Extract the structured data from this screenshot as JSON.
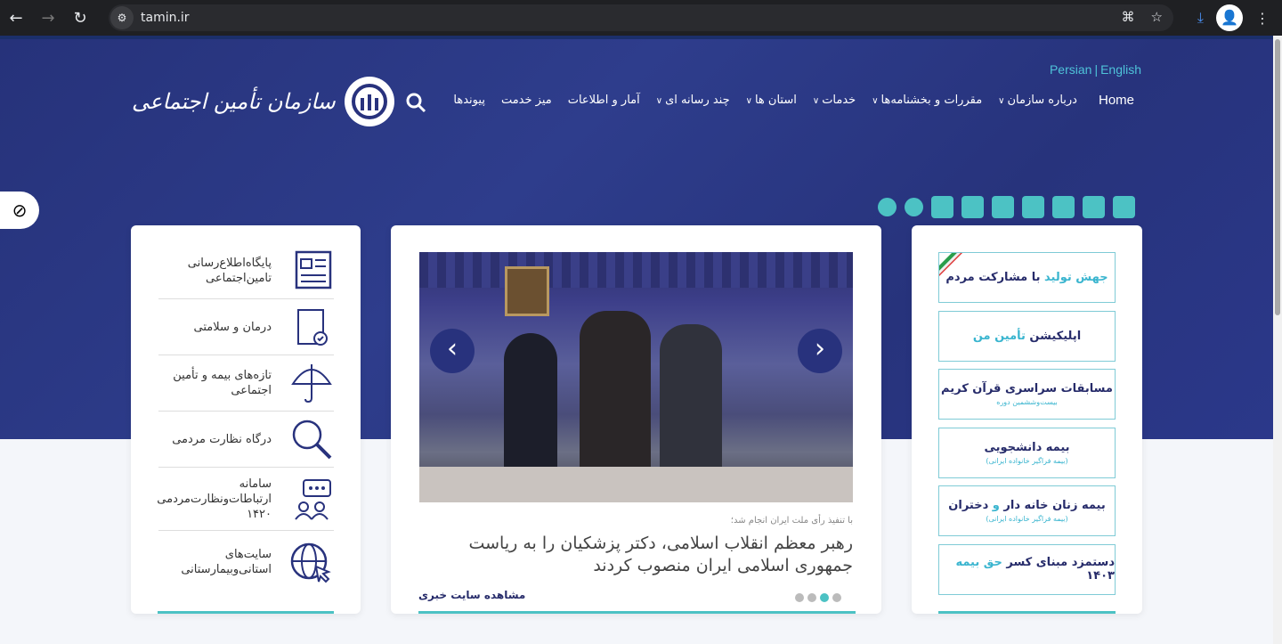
{
  "browser": {
    "url": "tamin.ir"
  },
  "header": {
    "lang": {
      "persian": "Persian",
      "english": "English"
    },
    "logo_text": "سازمان تأمین اجتماعی",
    "nav": [
      {
        "label": "Home",
        "dropdown": false
      },
      {
        "label": "درباره سازمان",
        "dropdown": true
      },
      {
        "label": "مقررات و بخشنامه‌ها",
        "dropdown": true
      },
      {
        "label": "خدمات",
        "dropdown": true
      },
      {
        "label": "استان ها",
        "dropdown": true
      },
      {
        "label": "چند رسانه ای",
        "dropdown": true
      },
      {
        "label": "آمار و اطلاعات",
        "dropdown": false
      },
      {
        "label": "میز خدمت",
        "dropdown": false
      },
      {
        "label": "پیوندها",
        "dropdown": false
      }
    ]
  },
  "toolbar_icons": [
    "zoom-out-icon",
    "zoom-in-icon",
    "sitemap-icon",
    "rss-icon",
    "mailbox-icon",
    "email-icon",
    "faq-icon",
    "mobile-icon",
    "home-icon"
  ],
  "left_panel": [
    {
      "label": "پایگاه‌اطلاع‌رسانی تامین‌اجتماعی",
      "icon": "newspaper-icon"
    },
    {
      "label": "درمان و سلامتی",
      "icon": "medical-report-icon"
    },
    {
      "label": "تازه‌های بیمه و تأمین اجتماعی",
      "icon": "umbrella-icon"
    },
    {
      "label": "درگاه نظارت مردمی",
      "icon": "magnifier-icon"
    },
    {
      "label": "سامانه ارتباطات‌ونظارت‌مردمی ۱۴۲۰",
      "icon": "chat-people-icon"
    },
    {
      "label": "سایت‌های استانی‌وبیمارستانی",
      "icon": "globe-cursor-icon"
    }
  ],
  "news": {
    "subtitle": "با تنفیذ رأی ملت ایران انجام شد؛",
    "headline": "رهبر معظم انقلاب اسلامی، دکتر پزشکیان را به ریاست جمهوری اسلامی ایران منصوب کردند",
    "more_link": "مشاهده سایت خبری",
    "slides": 4,
    "active_slide": 3
  },
  "right_panel": [
    {
      "parts": [
        {
          "t": "جهش تولید ",
          "c": true
        },
        {
          "t": "با مشارکت مردم",
          "c": false
        }
      ],
      "sub": ""
    },
    {
      "parts": [
        {
          "t": "اپلیکیشن ",
          "c": false
        },
        {
          "t": "تأمین من",
          "c": true
        }
      ],
      "sub": ""
    },
    {
      "parts": [
        {
          "t": "مسابقات سراسری قرآن کریم",
          "c": false
        }
      ],
      "sub": "بیست‌وششمین دوره"
    },
    {
      "parts": [
        {
          "t": "بیمه دانشجویی",
          "c": false
        }
      ],
      "sub": "(بیمه فراگیر خانواده ایرانی)"
    },
    {
      "parts": [
        {
          "t": "بیمه زنان خانه دار ",
          "c": false
        },
        {
          "t": "و ",
          "c": true
        },
        {
          "t": "دختران",
          "c": false
        }
      ],
      "sub": "(بیمه فراگیر خانواده ایرانی)"
    },
    {
      "parts": [
        {
          "t": "دستمزد مبنای کسر ",
          "c": false
        },
        {
          "t": "حق بیمه ",
          "c": true
        },
        {
          "t": "۱۴۰۳",
          "c": false
        }
      ],
      "sub": ""
    }
  ],
  "colors": {
    "primary": "#28327d",
    "accent": "#4cc2c4"
  }
}
